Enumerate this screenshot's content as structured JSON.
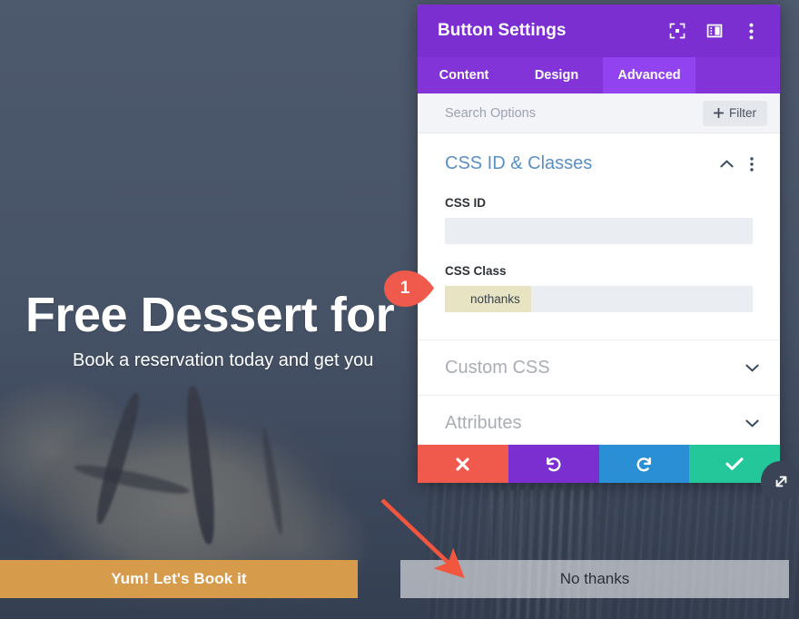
{
  "hero": {
    "title": "Free Dessert for",
    "subtitle": "Book a reservation today and get you",
    "primary_button": "Yum! Let's Book it",
    "secondary_button": "No thanks",
    "primary_button_color": "#d79b4c",
    "secondary_button_color": "#eceef0"
  },
  "annotation": {
    "marker_number": "1",
    "marker_color": "#ef5a4c",
    "arrow_color": "#f2563f"
  },
  "modal": {
    "title": "Button Settings",
    "header_color": "#7b2fd0",
    "header_icons": [
      {
        "name": "focus-icon",
        "label": "Focus"
      },
      {
        "name": "layout-icon",
        "label": "Layout"
      },
      {
        "name": "more-vertical-icon",
        "label": "More"
      }
    ],
    "tabs": [
      {
        "label": "Content",
        "active": false
      },
      {
        "label": "Design",
        "active": false
      },
      {
        "label": "Advanced",
        "active": true
      }
    ],
    "active_tab_color": "#9043ef",
    "search": {
      "placeholder": "Search Options",
      "value": "",
      "filter_label": "Filter"
    },
    "sections": [
      {
        "title": "CSS ID & Classes",
        "expanded": true,
        "title_color": "#5a8fc4",
        "fields": [
          {
            "label": "CSS ID",
            "value": "",
            "selected_text": ""
          },
          {
            "label": "CSS Class",
            "value": "nothanks",
            "selected_text": "nothanks"
          }
        ]
      },
      {
        "title": "Custom CSS",
        "expanded": false
      },
      {
        "title": "Attributes",
        "expanded": false
      }
    ],
    "footer_buttons": [
      {
        "name": "cancel-button",
        "icon": "close-icon",
        "color": "#ef5a4c"
      },
      {
        "name": "undo-button",
        "icon": "undo-icon",
        "color": "#7b2fd0"
      },
      {
        "name": "redo-button",
        "icon": "redo-icon",
        "color": "#2a8fd4"
      },
      {
        "name": "save-button",
        "icon": "check-icon",
        "color": "#24c79a"
      }
    ]
  }
}
